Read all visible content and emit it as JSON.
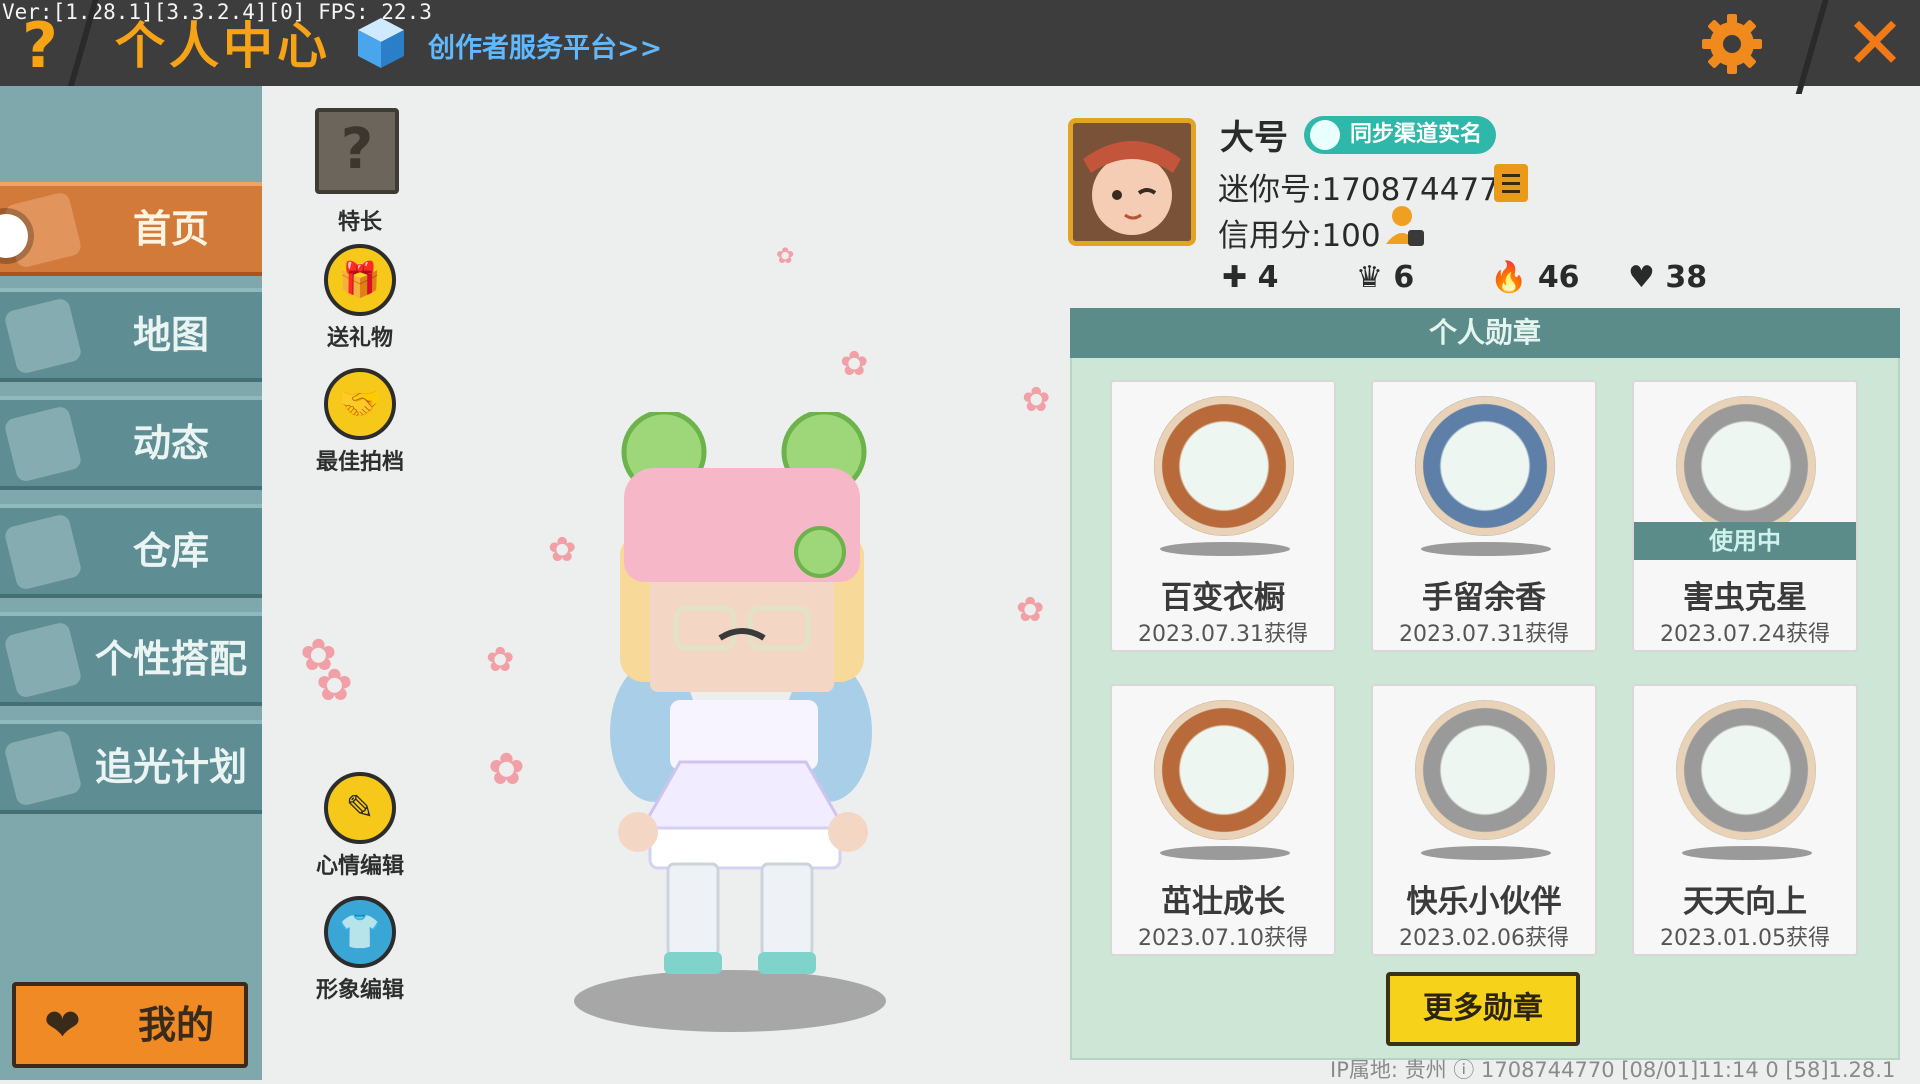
{
  "debug": {
    "version_text": "Ver:[1.28.1][3.3.2.4][0] FPS: 22.3"
  },
  "header": {
    "help_symbol": "?",
    "title": "个人中心",
    "creator_link": "创作者服务平台>>",
    "close_symbol": "✕",
    "icons": [
      "help-icon",
      "cube-logo-icon",
      "gear-icon",
      "close-icon"
    ]
  },
  "sidebar": {
    "items": [
      {
        "label": "首页",
        "active": true
      },
      {
        "label": "地图",
        "active": false
      },
      {
        "label": "动态",
        "active": false
      },
      {
        "label": "仓库",
        "active": false
      },
      {
        "label": "个性搭配",
        "active": false
      },
      {
        "label": "追光计划",
        "active": false
      }
    ],
    "my_button": "我的",
    "active_color": "#d27a3a",
    "item_color": "#5e8d94"
  },
  "actions": {
    "skill_symbol": "?",
    "skill_label": "特长",
    "gift_label": "送礼物",
    "best_photo_label": "最佳拍档",
    "mood_edit_label": "心情编辑",
    "image_edit_label": "形象编辑"
  },
  "profile": {
    "nickname": "大号",
    "real_name_badge": "同步渠道实名",
    "mini_id": "迷你号:1708744770",
    "credit": "信用分:100",
    "stats": {
      "plus": "4",
      "trophy": "6",
      "fire": "46",
      "heart": "38"
    }
  },
  "badges": {
    "header": "个人勋章",
    "in_use_label": "使用中",
    "items": [
      {
        "name": "百变衣橱",
        "date": "2023.07.31获得",
        "ring": "#b86a3a",
        "in_use": false
      },
      {
        "name": "手留余香",
        "date": "2023.07.31获得",
        "ring": "#5e7fa8",
        "in_use": false
      },
      {
        "name": "害虫克星",
        "date": "2023.07.24获得",
        "ring": "#9a9a9a",
        "in_use": true
      },
      {
        "name": "茁壮成长",
        "date": "2023.07.10获得",
        "ring": "#b86a3a",
        "in_use": false
      },
      {
        "name": "快乐小伙伴",
        "date": "2023.02.06获得",
        "ring": "#9a9a9a",
        "in_use": false
      },
      {
        "name": "天天向上",
        "date": "2023.01.05获得",
        "ring": "#9a9a9a",
        "in_use": false
      }
    ],
    "more_button": "更多勋章"
  },
  "footer": {
    "ip_location": "IP属地: 贵州",
    "info": "1708744770   [08/01]11:14 0  [58]1.28.1"
  }
}
